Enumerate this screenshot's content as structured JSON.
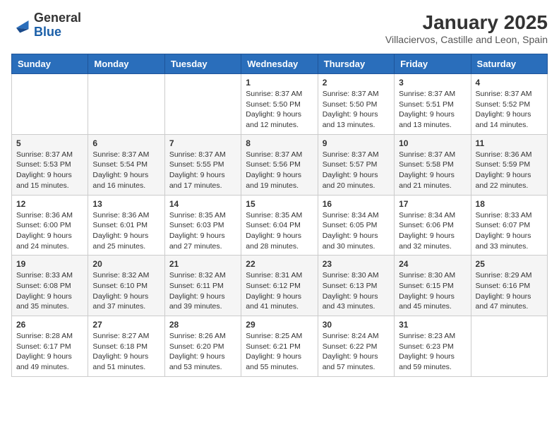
{
  "header": {
    "logo_general": "General",
    "logo_blue": "Blue",
    "month_title": "January 2025",
    "location": "Villaciervos, Castille and Leon, Spain"
  },
  "weekdays": [
    "Sunday",
    "Monday",
    "Tuesday",
    "Wednesday",
    "Thursday",
    "Friday",
    "Saturday"
  ],
  "weeks": [
    [
      {
        "day": "",
        "content": ""
      },
      {
        "day": "",
        "content": ""
      },
      {
        "day": "",
        "content": ""
      },
      {
        "day": "1",
        "content": "Sunrise: 8:37 AM\nSunset: 5:50 PM\nDaylight: 9 hours\nand 12 minutes."
      },
      {
        "day": "2",
        "content": "Sunrise: 8:37 AM\nSunset: 5:50 PM\nDaylight: 9 hours\nand 13 minutes."
      },
      {
        "day": "3",
        "content": "Sunrise: 8:37 AM\nSunset: 5:51 PM\nDaylight: 9 hours\nand 13 minutes."
      },
      {
        "day": "4",
        "content": "Sunrise: 8:37 AM\nSunset: 5:52 PM\nDaylight: 9 hours\nand 14 minutes."
      }
    ],
    [
      {
        "day": "5",
        "content": "Sunrise: 8:37 AM\nSunset: 5:53 PM\nDaylight: 9 hours\nand 15 minutes."
      },
      {
        "day": "6",
        "content": "Sunrise: 8:37 AM\nSunset: 5:54 PM\nDaylight: 9 hours\nand 16 minutes."
      },
      {
        "day": "7",
        "content": "Sunrise: 8:37 AM\nSunset: 5:55 PM\nDaylight: 9 hours\nand 17 minutes."
      },
      {
        "day": "8",
        "content": "Sunrise: 8:37 AM\nSunset: 5:56 PM\nDaylight: 9 hours\nand 19 minutes."
      },
      {
        "day": "9",
        "content": "Sunrise: 8:37 AM\nSunset: 5:57 PM\nDaylight: 9 hours\nand 20 minutes."
      },
      {
        "day": "10",
        "content": "Sunrise: 8:37 AM\nSunset: 5:58 PM\nDaylight: 9 hours\nand 21 minutes."
      },
      {
        "day": "11",
        "content": "Sunrise: 8:36 AM\nSunset: 5:59 PM\nDaylight: 9 hours\nand 22 minutes."
      }
    ],
    [
      {
        "day": "12",
        "content": "Sunrise: 8:36 AM\nSunset: 6:00 PM\nDaylight: 9 hours\nand 24 minutes."
      },
      {
        "day": "13",
        "content": "Sunrise: 8:36 AM\nSunset: 6:01 PM\nDaylight: 9 hours\nand 25 minutes."
      },
      {
        "day": "14",
        "content": "Sunrise: 8:35 AM\nSunset: 6:03 PM\nDaylight: 9 hours\nand 27 minutes."
      },
      {
        "day": "15",
        "content": "Sunrise: 8:35 AM\nSunset: 6:04 PM\nDaylight: 9 hours\nand 28 minutes."
      },
      {
        "day": "16",
        "content": "Sunrise: 8:34 AM\nSunset: 6:05 PM\nDaylight: 9 hours\nand 30 minutes."
      },
      {
        "day": "17",
        "content": "Sunrise: 8:34 AM\nSunset: 6:06 PM\nDaylight: 9 hours\nand 32 minutes."
      },
      {
        "day": "18",
        "content": "Sunrise: 8:33 AM\nSunset: 6:07 PM\nDaylight: 9 hours\nand 33 minutes."
      }
    ],
    [
      {
        "day": "19",
        "content": "Sunrise: 8:33 AM\nSunset: 6:08 PM\nDaylight: 9 hours\nand 35 minutes."
      },
      {
        "day": "20",
        "content": "Sunrise: 8:32 AM\nSunset: 6:10 PM\nDaylight: 9 hours\nand 37 minutes."
      },
      {
        "day": "21",
        "content": "Sunrise: 8:32 AM\nSunset: 6:11 PM\nDaylight: 9 hours\nand 39 minutes."
      },
      {
        "day": "22",
        "content": "Sunrise: 8:31 AM\nSunset: 6:12 PM\nDaylight: 9 hours\nand 41 minutes."
      },
      {
        "day": "23",
        "content": "Sunrise: 8:30 AM\nSunset: 6:13 PM\nDaylight: 9 hours\nand 43 minutes."
      },
      {
        "day": "24",
        "content": "Sunrise: 8:30 AM\nSunset: 6:15 PM\nDaylight: 9 hours\nand 45 minutes."
      },
      {
        "day": "25",
        "content": "Sunrise: 8:29 AM\nSunset: 6:16 PM\nDaylight: 9 hours\nand 47 minutes."
      }
    ],
    [
      {
        "day": "26",
        "content": "Sunrise: 8:28 AM\nSunset: 6:17 PM\nDaylight: 9 hours\nand 49 minutes."
      },
      {
        "day": "27",
        "content": "Sunrise: 8:27 AM\nSunset: 6:18 PM\nDaylight: 9 hours\nand 51 minutes."
      },
      {
        "day": "28",
        "content": "Sunrise: 8:26 AM\nSunset: 6:20 PM\nDaylight: 9 hours\nand 53 minutes."
      },
      {
        "day": "29",
        "content": "Sunrise: 8:25 AM\nSunset: 6:21 PM\nDaylight: 9 hours\nand 55 minutes."
      },
      {
        "day": "30",
        "content": "Sunrise: 8:24 AM\nSunset: 6:22 PM\nDaylight: 9 hours\nand 57 minutes."
      },
      {
        "day": "31",
        "content": "Sunrise: 8:23 AM\nSunset: 6:23 PM\nDaylight: 9 hours\nand 59 minutes."
      },
      {
        "day": "",
        "content": ""
      }
    ]
  ]
}
